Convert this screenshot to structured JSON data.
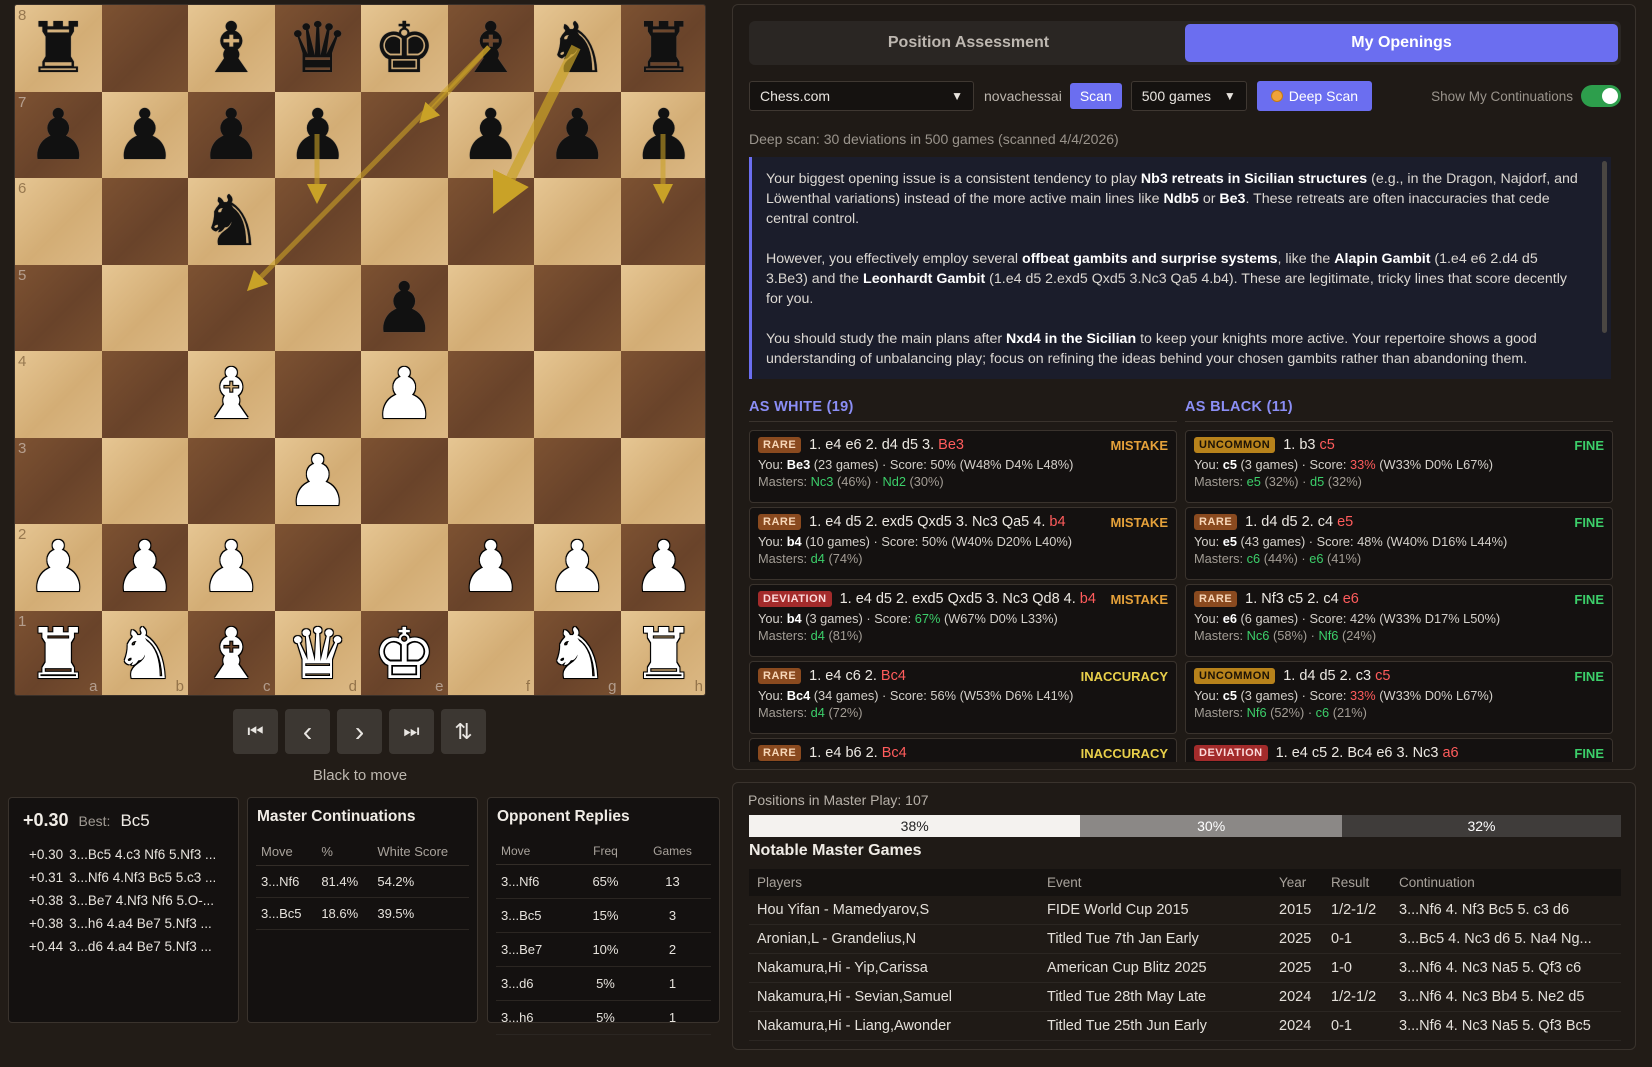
{
  "board": {
    "ranks": [
      "8",
      "7",
      "6",
      "5",
      "4",
      "3",
      "2",
      "1"
    ],
    "files": [
      "a",
      "b",
      "c",
      "d",
      "e",
      "f",
      "g",
      "h"
    ],
    "rows": [
      [
        "bR",
        "",
        "bB",
        "bQ",
        "bK",
        "bB",
        "bN",
        "bR"
      ],
      [
        "bP",
        "bP",
        "bP",
        "bP",
        "",
        "bP",
        "bP",
        "bP"
      ],
      [
        "",
        "",
        "bN",
        "",
        "",
        "",
        "",
        ""
      ],
      [
        "",
        "",
        "",
        "",
        "bP",
        "",
        "",
        ""
      ],
      [
        "",
        "",
        "wB",
        "",
        "wP",
        "",
        "",
        ""
      ],
      [
        "",
        "",
        "",
        "wP",
        "",
        "",
        "",
        ""
      ],
      [
        "wP",
        "wP",
        "wP",
        "",
        "",
        "wP",
        "wP",
        "wP"
      ],
      [
        "wR",
        "wN",
        "wB",
        "wQ",
        "wK",
        "",
        "wN",
        "wR"
      ]
    ],
    "arrow_color": "#c9a227"
  },
  "nav": {
    "first_icon": "⏮",
    "prev_icon": "‹",
    "next_icon": "›",
    "last_icon": "⏭",
    "flip_icon": "⇅"
  },
  "to_move": "Black to move",
  "engine": {
    "eval": "+0.30",
    "best_label": "Best:",
    "best_move": "Bc5",
    "lines": [
      {
        "value": "+0.30",
        "moves": "3...Bc5 4.c3 Nf6 5.Nf3 ..."
      },
      {
        "value": "+0.31",
        "moves": "3...Nf6 4.Nf3 Bc5 5.c3 ..."
      },
      {
        "value": "+0.38",
        "moves": "3...Be7 4.Nf3 Nf6 5.O-..."
      },
      {
        "value": "+0.38",
        "moves": "3...h6 4.a4 Be7 5.Nf3 ..."
      },
      {
        "value": "+0.44",
        "moves": "3...d6 4.a4 Be7 5.Nf3 ..."
      }
    ]
  },
  "master_continuations": {
    "title": "Master Continuations",
    "headers": [
      "Move",
      "%",
      "White Score"
    ],
    "rows": [
      [
        "3...Nf6",
        "81.4%",
        "54.2%"
      ],
      [
        "3...Bc5",
        "18.6%",
        "39.5%"
      ]
    ]
  },
  "opponent_replies": {
    "title": "Opponent Replies",
    "headers": [
      "Move",
      "Freq",
      "Games"
    ],
    "rows": [
      [
        "3...Nf6",
        "65%",
        "13"
      ],
      [
        "3...Bc5",
        "15%",
        "3"
      ],
      [
        "3...Be7",
        "10%",
        "2"
      ],
      [
        "3...d6",
        "5%",
        "1"
      ],
      [
        "3...h6",
        "5%",
        "1"
      ]
    ]
  },
  "tabs": [
    {
      "label": "Position Assessment",
      "active": false
    },
    {
      "label": "My Openings",
      "active": true
    }
  ],
  "controls": {
    "platform": "Chess.com",
    "username": "novachessai",
    "scan_label": "Scan",
    "games": "500 games",
    "deep_scan_label": "Deep Scan",
    "toggle_label": "Show My Continuations",
    "toggle_on": true
  },
  "scan_info": "Deep scan: 30 deviations in 500 games (scanned 4/4/2026)",
  "advice": {
    "p1": {
      "t1": "Your biggest opening issue is a consistent tendency to play ",
      "b1": "Nb3 retreats in Sicilian structures",
      "t2": " (e.g., in the Dragon, Najdorf, and Löwenthal variations) instead of the more active main lines like ",
      "b2": "Ndb5",
      "t3": " or ",
      "b3": "Be3",
      "t4": ". These retreats are often inaccuracies that cede central control."
    },
    "p2": {
      "t1": "However, you effectively employ several ",
      "b1": "offbeat gambits and surprise systems",
      "t2": ", like the ",
      "b2": "Alapin Gambit",
      "t3": " (1.e4 e6 2.d4 d5 3.Be3) and the ",
      "b3": "Leonhardt Gambit",
      "t4": " (1.e4 d5 2.exd5 Qxd5 3.Nc3 Qa5 4.b4). These are legitimate, tricky lines that score decently for you."
    },
    "p3": {
      "t1": "You should study the main plans after ",
      "b1": "Nxd4 in the Sicilian",
      "t2": " to keep your knights more active. Your repertoire shows a good understanding of unbalancing play; focus on refining the ideas behind your chosen gambits rather than abandoning them."
    }
  },
  "as_white": {
    "heading": "AS WHITE (19)",
    "cards": [
      {
        "badge": "RARE",
        "badge_type": "rare",
        "moves": "1. e4 e6 2. d4 d5 3.",
        "move": "Be3",
        "verdict": "MISTAKE",
        "verdict_type": "mistake",
        "you_label": "You:",
        "you_move": "Be3",
        "you_games": "(23 games) · Score:",
        "score": "50%",
        "score_type": "",
        "wdl": "(W48% D4% L48%)",
        "masters_label": "Masters:",
        "m1": "Nc3",
        "m1p": "(46%) ·",
        "m2": "Nd2",
        "m2p": "(30%)"
      },
      {
        "badge": "RARE",
        "badge_type": "rare",
        "moves": "1. e4 d5 2. exd5 Qxd5 3. Nc3 Qa5 4.",
        "move": "b4",
        "verdict": "MISTAKE",
        "verdict_type": "mistake",
        "you_label": "You:",
        "you_move": "b4",
        "you_games": "(10 games) · Score:",
        "score": "50%",
        "score_type": "",
        "wdl": "(W40% D20% L40%)",
        "masters_label": "Masters:",
        "m1": "d4",
        "m1p": "(74%)",
        "m2": "",
        "m2p": ""
      },
      {
        "badge": "DEVIATION",
        "badge_type": "deviation",
        "moves": "1. e4 d5 2. exd5 Qxd5 3. Nc3 Qd8 4.",
        "move": "b4",
        "verdict": "MISTAKE",
        "verdict_type": "mistake",
        "you_label": "You:",
        "you_move": "b4",
        "you_games": "(3 games) · Score:",
        "score": "67%",
        "score_type": "g",
        "wdl": "(W67% D0% L33%)",
        "masters_label": "Masters:",
        "m1": "d4",
        "m1p": "(81%)",
        "m2": "",
        "m2p": ""
      },
      {
        "badge": "RARE",
        "badge_type": "rare",
        "moves": "1. e4 c6 2.",
        "move": "Bc4",
        "verdict": "INACCURACY",
        "verdict_type": "inaccuracy",
        "you_label": "You:",
        "you_move": "Bc4",
        "you_games": "(34 games) · Score:",
        "score": "56%",
        "score_type": "",
        "wdl": "(W53% D6% L41%)",
        "masters_label": "Masters:",
        "m1": "d4",
        "m1p": "(72%)",
        "m2": "",
        "m2p": ""
      },
      {
        "badge": "RARE",
        "badge_type": "rare",
        "moves": "1. e4 b6 2.",
        "move": "Bc4",
        "verdict": "INACCURACY",
        "verdict_type": "inaccuracy",
        "you_label": "",
        "you_move": "",
        "you_games": "",
        "score": "",
        "score_type": "",
        "wdl": "",
        "masters_label": "",
        "m1": "",
        "m1p": "",
        "m2": "",
        "m2p": ""
      }
    ]
  },
  "as_black": {
    "heading": "AS BLACK (11)",
    "cards": [
      {
        "badge": "UNCOMMON",
        "badge_type": "uncommon",
        "moves": "1. b3",
        "move": "c5",
        "verdict": "FINE",
        "verdict_type": "fine",
        "you_label": "You:",
        "you_move": "c5",
        "you_games": "(3 games) · Score:",
        "score": "33%",
        "score_type": "r",
        "wdl": "(W33% D0% L67%)",
        "masters_label": "Masters:",
        "m1": "e5",
        "m1p": "(32%) ·",
        "m2": "d5",
        "m2p": "(32%)"
      },
      {
        "badge": "RARE",
        "badge_type": "rare",
        "moves": "1. d4 d5 2. c4",
        "move": "e5",
        "verdict": "FINE",
        "verdict_type": "fine",
        "you_label": "You:",
        "you_move": "e5",
        "you_games": "(43 games) · Score:",
        "score": "48%",
        "score_type": "",
        "wdl": "(W40% D16% L44%)",
        "masters_label": "Masters:",
        "m1": "c6",
        "m1p": "(44%) ·",
        "m2": "e6",
        "m2p": "(41%)"
      },
      {
        "badge": "RARE",
        "badge_type": "rare",
        "moves": "1. Nf3 c5 2. c4",
        "move": "e6",
        "verdict": "FINE",
        "verdict_type": "fine",
        "you_label": "You:",
        "you_move": "e6",
        "you_games": "(6 games) · Score:",
        "score": "42%",
        "score_type": "",
        "wdl": "(W33% D17% L50%)",
        "masters_label": "Masters:",
        "m1": "Nc6",
        "m1p": "(58%) ·",
        "m2": "Nf6",
        "m2p": "(24%)"
      },
      {
        "badge": "UNCOMMON",
        "badge_type": "uncommon",
        "moves": "1. d4 d5 2. c3",
        "move": "c5",
        "verdict": "FINE",
        "verdict_type": "fine",
        "you_label": "You:",
        "you_move": "c5",
        "you_games": "(3 games) · Score:",
        "score": "33%",
        "score_type": "r",
        "wdl": "(W33% D0% L67%)",
        "masters_label": "Masters:",
        "m1": "Nf6",
        "m1p": "(52%) ·",
        "m2": "c6",
        "m2p": "(21%)"
      },
      {
        "badge": "DEVIATION",
        "badge_type": "deviation",
        "moves": "1. e4 c5 2. Bc4 e6 3. Nc3",
        "move": "a6",
        "verdict": "FINE",
        "verdict_type": "fine",
        "you_label": "",
        "you_move": "",
        "you_games": "",
        "score": "",
        "score_type": "",
        "wdl": "",
        "masters_label": "",
        "m1": "",
        "m1p": "",
        "m2": "",
        "m2p": ""
      }
    ]
  },
  "master_play": {
    "positions": "Positions in Master Play: 107",
    "white_pct": "38%",
    "draw_pct": "30%",
    "black_pct": "32%",
    "white_frac": 0.38,
    "draw_frac": 0.3,
    "black_frac": 0.32
  },
  "notable_games": {
    "title": "Notable Master Games",
    "headers": [
      "Players",
      "Event",
      "Year",
      "Result",
      "Continuation"
    ],
    "rows": [
      [
        "Hou Yifan - Mamedyarov,S",
        "FIDE World Cup 2015",
        "2015",
        "1/2-1/2",
        "3...Nf6 4. Nf3 Bc5 5. c3 d6"
      ],
      [
        "Aronian,L - Grandelius,N",
        "Titled Tue 7th Jan Early",
        "2025",
        "0-1",
        "3...Bc5 4. Nc3 d6 5. Na4 Ng..."
      ],
      [
        "Nakamura,Hi - Yip,Carissa",
        "American Cup Blitz 2025",
        "2025",
        "1-0",
        "3...Nf6 4. Nc3 Na5 5. Qf3 c6"
      ],
      [
        "Nakamura,Hi - Sevian,Samuel",
        "Titled Tue 28th May Late",
        "2024",
        "1/2-1/2",
        "3...Nf6 4. Nc3 Bb4 5. Ne2 d5"
      ],
      [
        "Nakamura,Hi - Liang,Awonder",
        "Titled Tue 25th Jun Early",
        "2024",
        "0-1",
        "3...Nf6 4. Nc3 Na5 5. Qf3 Bc5"
      ]
    ]
  }
}
